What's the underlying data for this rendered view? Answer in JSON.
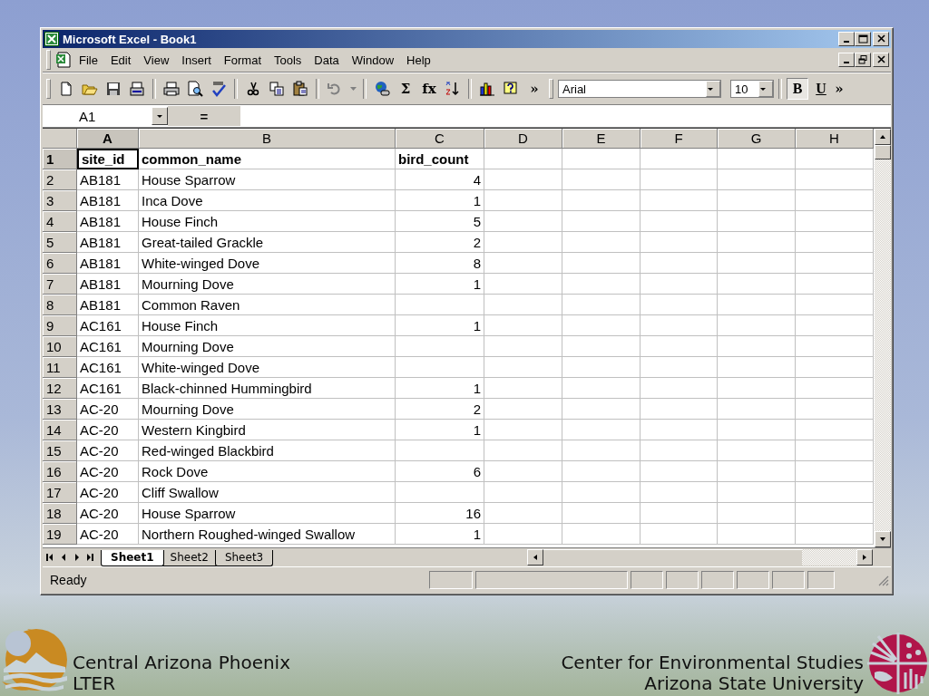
{
  "window": {
    "title": "Microsoft Excel - Book1"
  },
  "menu": [
    "File",
    "Edit",
    "View",
    "Insert",
    "Format",
    "Tools",
    "Data",
    "Window",
    "Help"
  ],
  "toolbar": [
    {
      "kind": "new"
    },
    {
      "kind": "open"
    },
    {
      "kind": "save"
    },
    {
      "kind": "mail"
    },
    {
      "kind": "separator"
    },
    {
      "kind": "print"
    },
    {
      "kind": "preview"
    },
    {
      "kind": "spelling"
    },
    {
      "kind": "separator"
    },
    {
      "kind": "cut"
    },
    {
      "kind": "copy"
    },
    {
      "kind": "paste"
    },
    {
      "kind": "separator"
    },
    {
      "kind": "undo"
    },
    {
      "kind": "dropdown"
    },
    {
      "kind": "separator"
    },
    {
      "kind": "web"
    },
    {
      "kind": "glyph",
      "glyph": "Σ"
    },
    {
      "kind": "glyph",
      "glyph": "fx"
    },
    {
      "kind": "sort"
    },
    {
      "kind": "separator"
    },
    {
      "kind": "chart"
    },
    {
      "kind": "help"
    },
    {
      "kind": "glyph",
      "glyph": "»"
    }
  ],
  "format_toolbar": {
    "font": "Arial",
    "size": "10",
    "buttons": [
      {
        "label": "B",
        "pressed": true
      },
      {
        "label": "U",
        "pressed": false
      }
    ],
    "more": "»"
  },
  "formula_bar": {
    "name_box": "A1",
    "equals": "="
  },
  "columns": [
    {
      "label": "A",
      "selected": true
    },
    {
      "label": "B",
      "selected": false
    },
    {
      "label": "C",
      "selected": false
    },
    {
      "label": "D",
      "selected": false
    },
    {
      "label": "E",
      "selected": false
    },
    {
      "label": "F",
      "selected": false
    },
    {
      "label": "G",
      "selected": false
    },
    {
      "label": "H",
      "selected": false
    }
  ],
  "rows": [
    {
      "number": "1",
      "selected": true,
      "bold": true,
      "cells": [
        "site_id",
        "common_name",
        "bird_count"
      ]
    },
    {
      "number": "2",
      "selected": false,
      "bold": false,
      "cells": [
        "AB181",
        "House Sparrow",
        "4"
      ]
    },
    {
      "number": "3",
      "selected": false,
      "bold": false,
      "cells": [
        "AB181",
        "Inca Dove",
        "1"
      ]
    },
    {
      "number": "4",
      "selected": false,
      "bold": false,
      "cells": [
        "AB181",
        "House Finch",
        "5"
      ]
    },
    {
      "number": "5",
      "selected": false,
      "bold": false,
      "cells": [
        "AB181",
        "Great-tailed Grackle",
        "2"
      ]
    },
    {
      "number": "6",
      "selected": false,
      "bold": false,
      "cells": [
        "AB181",
        "White-winged Dove",
        "8"
      ]
    },
    {
      "number": "7",
      "selected": false,
      "bold": false,
      "cells": [
        "AB181",
        "Mourning Dove",
        "1"
      ]
    },
    {
      "number": "8",
      "selected": false,
      "bold": false,
      "cells": [
        "AB181",
        "Common Raven",
        null
      ]
    },
    {
      "number": "9",
      "selected": false,
      "bold": false,
      "cells": [
        "AC161",
        "House Finch",
        "1"
      ]
    },
    {
      "number": "10",
      "selected": false,
      "bold": false,
      "cells": [
        "AC161",
        "Mourning Dove",
        null
      ]
    },
    {
      "number": "11",
      "selected": false,
      "bold": false,
      "cells": [
        "AC161",
        "White-winged Dove",
        null
      ]
    },
    {
      "number": "12",
      "selected": false,
      "bold": false,
      "cells": [
        "AC161",
        "Black-chinned Hummingbird",
        "1"
      ]
    },
    {
      "number": "13",
      "selected": false,
      "bold": false,
      "cells": [
        "AC-20",
        "Mourning Dove",
        "2"
      ]
    },
    {
      "number": "14",
      "selected": false,
      "bold": false,
      "cells": [
        "AC-20",
        "Western Kingbird",
        "1"
      ]
    },
    {
      "number": "15",
      "selected": false,
      "bold": false,
      "cells": [
        "AC-20",
        "Red-winged Blackbird",
        null
      ]
    },
    {
      "number": "16",
      "selected": false,
      "bold": false,
      "cells": [
        "AC-20",
        "Rock Dove",
        "6"
      ]
    },
    {
      "number": "17",
      "selected": false,
      "bold": false,
      "cells": [
        "AC-20",
        "Cliff Swallow",
        null
      ]
    },
    {
      "number": "18",
      "selected": false,
      "bold": false,
      "cells": [
        "AC-20",
        "House Sparrow",
        "16"
      ]
    },
    {
      "number": "19",
      "selected": false,
      "bold": false,
      "cells": [
        "AC-20",
        "Northern Roughed-winged Swallow",
        "1"
      ]
    }
  ],
  "sheet_tabs": [
    {
      "label": "Sheet1",
      "selected": true
    },
    {
      "label": "Sheet2",
      "selected": false
    },
    {
      "label": "Sheet3",
      "selected": false
    }
  ],
  "status_bar": {
    "text": "Ready"
  },
  "footer": {
    "left": [
      "Central Arizona Phoenix",
      "LTER"
    ],
    "right": [
      "Center for Environmental Studies",
      "Arizona State University"
    ]
  }
}
